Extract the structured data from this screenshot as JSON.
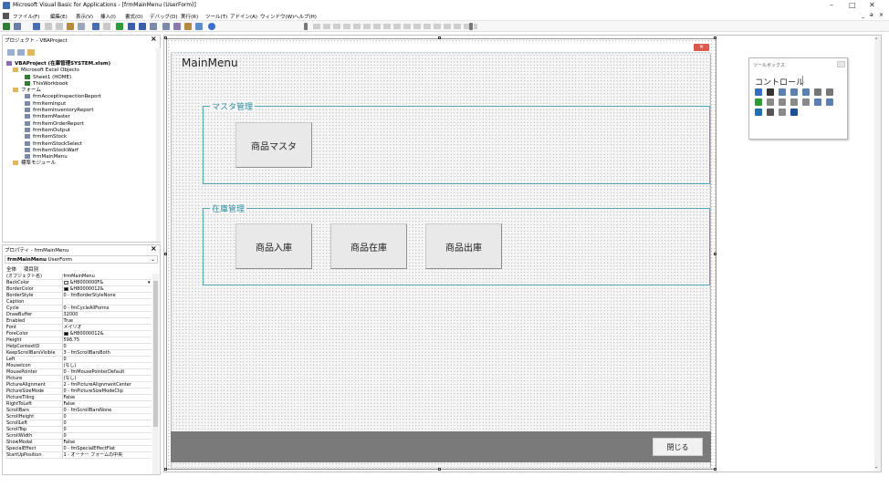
{
  "window": {
    "title": "Microsoft Visual Basic for Applications - [frmMainMenu (UserForm)]",
    "controls": [
      "–",
      "□",
      "✕"
    ],
    "mdi_controls": [
      "_",
      "ə",
      "×"
    ]
  },
  "menu": {
    "items": [
      "ファイル(F)",
      "編集(E)",
      "表示(V)",
      "挿入(I)",
      "書式(O)",
      "デバッグ(D)",
      "実行(R)",
      "ツール(T)",
      "アドイン(A)",
      "ウィンドウ(W)",
      "ヘルプ(H)"
    ]
  },
  "project_pane": {
    "title": "プロジェクト - VBAProject",
    "close": "×",
    "tree": [
      {
        "label": "VBAProject (在庫管理SYSTEM.xlsm)",
        "icon": "project-icon",
        "level": 0,
        "bold": true
      },
      {
        "label": "Microsoft Excel Objects",
        "icon": "folder-icon",
        "level": 1
      },
      {
        "label": "Sheet1 (HOME)",
        "icon": "sheet-icon",
        "level": 2
      },
      {
        "label": "ThisWorkbook",
        "icon": "workbook-icon",
        "level": 2
      },
      {
        "label": "フォーム",
        "icon": "folder-icon",
        "level": 1
      },
      {
        "label": "frmAcceptInspectionReport",
        "icon": "form-icon",
        "level": 2
      },
      {
        "label": "frmItemInput",
        "icon": "form-icon",
        "level": 2
      },
      {
        "label": "frmItemInventoryReport",
        "icon": "form-icon",
        "level": 2
      },
      {
        "label": "frmItemMaster",
        "icon": "form-icon",
        "level": 2
      },
      {
        "label": "frmItemOrderReport",
        "icon": "form-icon",
        "level": 2
      },
      {
        "label": "frmItemOutput",
        "icon": "form-icon",
        "level": 2
      },
      {
        "label": "frmItemStock",
        "icon": "form-icon",
        "level": 2
      },
      {
        "label": "frmItemStockSelect",
        "icon": "form-icon",
        "level": 2
      },
      {
        "label": "frmItemStockWarf",
        "icon": "form-icon",
        "level": 2
      },
      {
        "label": "frmMainMenu",
        "icon": "form-icon",
        "level": 2
      },
      {
        "label": "標準モジュール",
        "icon": "folder-icon",
        "level": 1
      }
    ]
  },
  "properties_pane": {
    "title": "プロパティ - frmMainMenu",
    "close": "×",
    "object": "frmMainMenu",
    "object_type": "UserForm",
    "tabs": [
      "全体",
      "項目別"
    ],
    "rows": [
      {
        "name": "(オブジェクト名)",
        "value": "frmMainMenu"
      },
      {
        "name": "BackColor",
        "value": "&H8000000F&",
        "swatch": "#f0f0f0"
      },
      {
        "name": "BorderColor",
        "value": "&H80000012&",
        "swatch": "#000000"
      },
      {
        "name": "BorderStyle",
        "value": "0 - fmBorderStyleNone"
      },
      {
        "name": "Caption",
        "value": ""
      },
      {
        "name": "Cycle",
        "value": "0 - fmCycleAllForms"
      },
      {
        "name": "DrawBuffer",
        "value": "32000"
      },
      {
        "name": "Enabled",
        "value": "True"
      },
      {
        "name": "Font",
        "value": "メイリオ"
      },
      {
        "name": "ForeColor",
        "value": "&H80000012&",
        "swatch": "#000000"
      },
      {
        "name": "Height",
        "value": "598.75"
      },
      {
        "name": "HelpContextID",
        "value": "0"
      },
      {
        "name": "KeepScrollBarsVisible",
        "value": "3 - fmScrollBarsBoth"
      },
      {
        "name": "Left",
        "value": "0"
      },
      {
        "name": "MouseIcon",
        "value": "(なし)"
      },
      {
        "name": "MousePointer",
        "value": "0 - fmMousePointerDefault"
      },
      {
        "name": "Picture",
        "value": "(なし)"
      },
      {
        "name": "PictureAlignment",
        "value": "2 - fmPictureAlignmentCenter"
      },
      {
        "name": "PictureSizeMode",
        "value": "0 - fmPictureSizeModeClip"
      },
      {
        "name": "PictureTiling",
        "value": "False"
      },
      {
        "name": "RightToLeft",
        "value": "False"
      },
      {
        "name": "ScrollBars",
        "value": "0 - fmScrollBarsNone"
      },
      {
        "name": "ScrollHeight",
        "value": "0"
      },
      {
        "name": "ScrollLeft",
        "value": "0"
      },
      {
        "name": "ScrollTop",
        "value": "0"
      },
      {
        "name": "ScrollWidth",
        "value": "0"
      },
      {
        "name": "ShowModal",
        "value": "False"
      },
      {
        "name": "SpecialEffect",
        "value": "0 - fmSpecialEffectFlat"
      },
      {
        "name": "StartUpPosition",
        "value": "1 - オーナー フォームの中央"
      }
    ]
  },
  "userform": {
    "title": "MainMenu",
    "close_glyph": "✕",
    "frames": [
      {
        "caption": "マスタ管理",
        "buttons": [
          "商品マスタ"
        ]
      },
      {
        "caption": "在庫管理",
        "buttons": [
          "商品入庫",
          "商品在庫",
          "商品出庫"
        ]
      }
    ],
    "close_button": "閉じる"
  },
  "toolbox": {
    "title": "ツールボックス",
    "tab": "コントロール",
    "tools": [
      "pointer-icon",
      "label-icon",
      "textbox-icon",
      "combobox-icon",
      "listbox-icon",
      "checkbox-icon",
      "optionbutton-icon",
      "togglebutton-icon",
      "frame-icon",
      "commandbutton-icon",
      "tabstrip-icon",
      "multipage-icon",
      "scrollbar-icon",
      "spinbutton-icon",
      "image-icon",
      "refedit-icon",
      "listview-icon",
      "treeview-icon"
    ]
  },
  "colors": {
    "frame_border": "#52a6b3",
    "frame_caption": "#2c8b9b",
    "footer": "#7a7a7a"
  }
}
